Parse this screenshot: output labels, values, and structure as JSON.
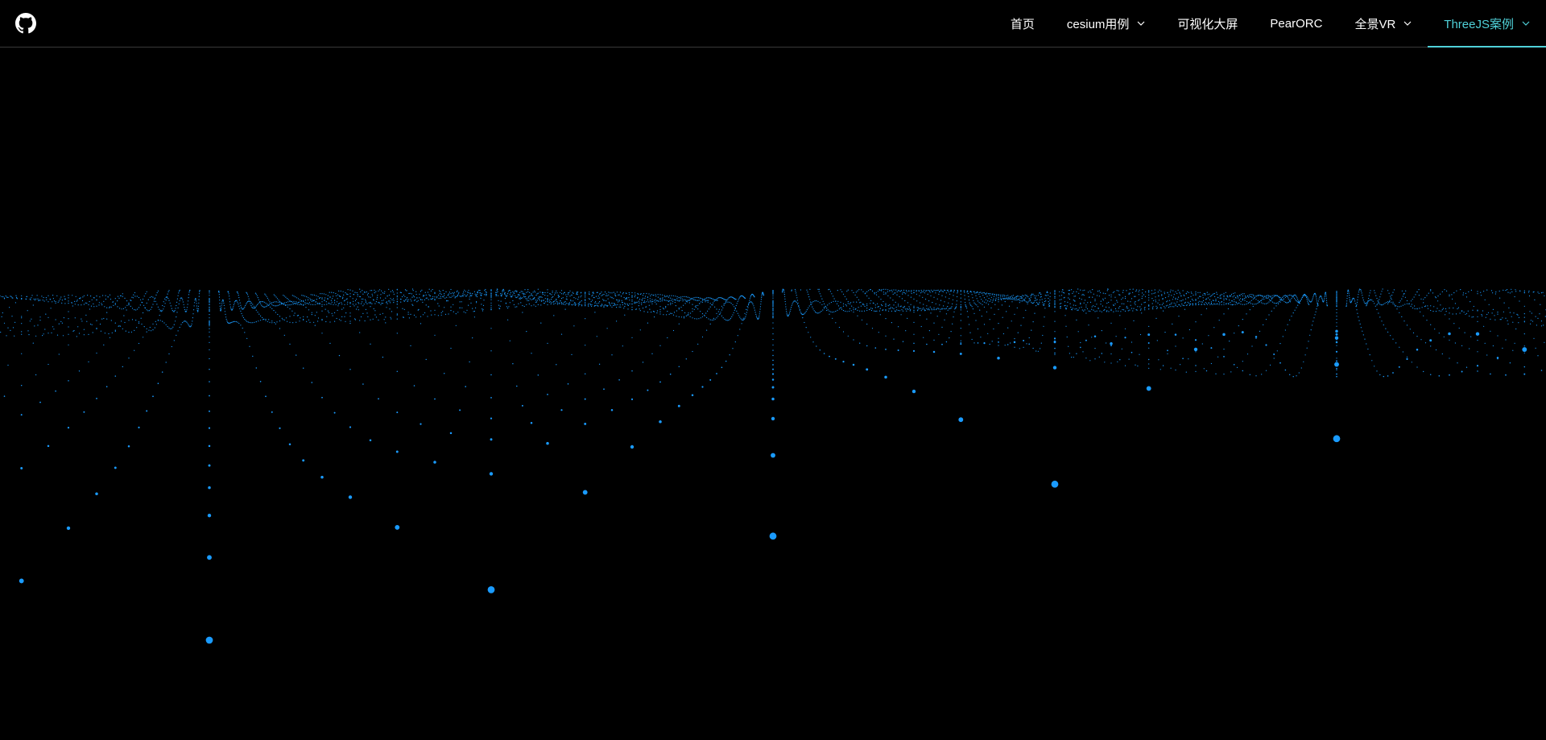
{
  "header": {
    "logo_icon": "github-icon",
    "nav": [
      {
        "label": "首页",
        "has_dropdown": false,
        "active": false
      },
      {
        "label": "cesium用例",
        "has_dropdown": true,
        "active": false
      },
      {
        "label": "可视化大屏",
        "has_dropdown": false,
        "active": false
      },
      {
        "label": "PearORC",
        "has_dropdown": false,
        "active": false
      },
      {
        "label": "全景VR",
        "has_dropdown": true,
        "active": false
      },
      {
        "label": "ThreeJS案例",
        "has_dropdown": true,
        "active": true
      }
    ]
  },
  "scene": {
    "type": "particle-wave",
    "point_color": "#1a9bff",
    "background": "#000000",
    "accent_color": "#4fd1d9"
  }
}
